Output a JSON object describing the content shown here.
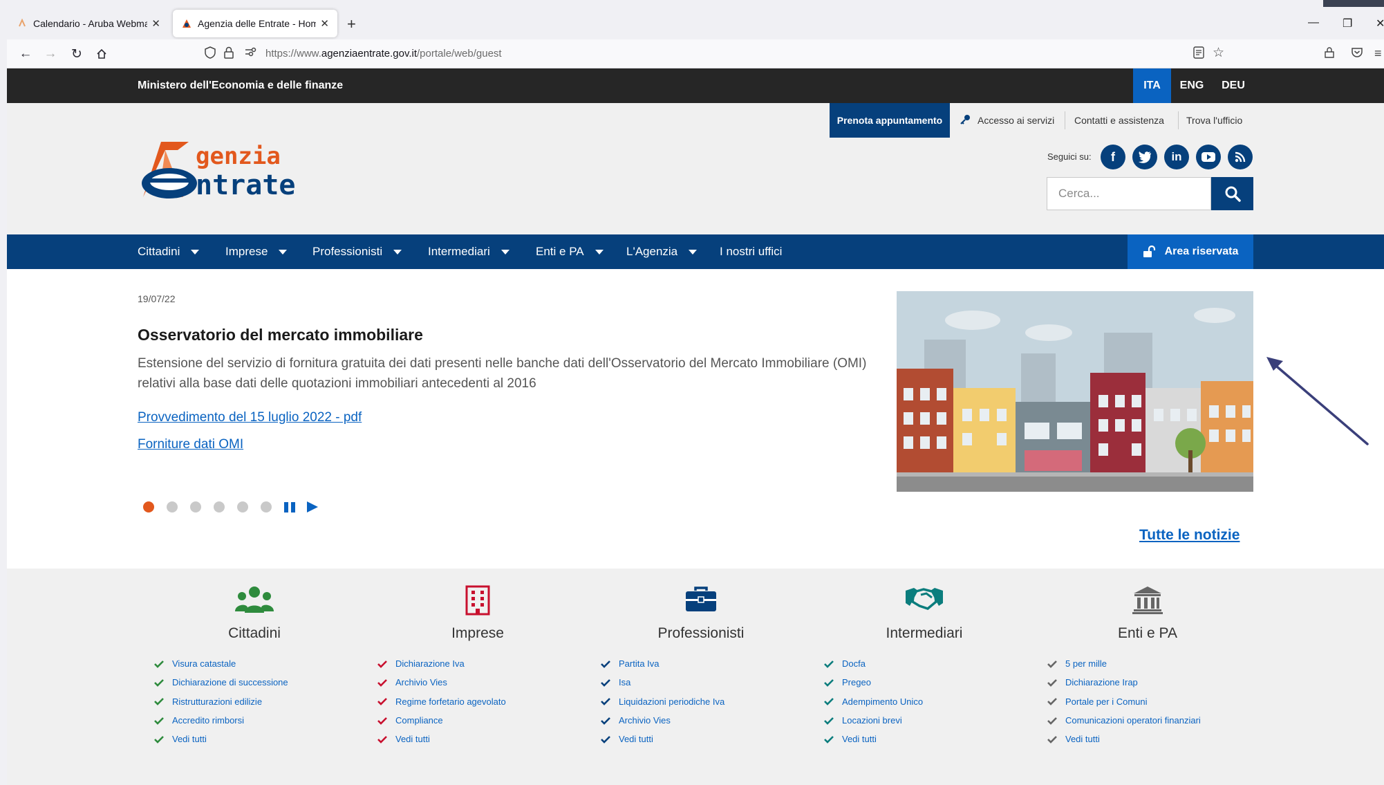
{
  "browser": {
    "tabs": [
      {
        "title": "Calendario - Aruba Webmail",
        "favicon": "aruba-icon",
        "active": false
      },
      {
        "title": "Agenzia delle Entrate - Home",
        "favicon": "agenzia-icon",
        "active": true
      }
    ],
    "url_prefix": "https://www.",
    "url_domain": "agenziaentrate.gov.it",
    "url_path": "/portale/web/guest"
  },
  "ministry_bar": {
    "name": "Ministero dell'Economia e delle finanze",
    "languages": [
      "ITA",
      "ENG",
      "DEU"
    ],
    "active_language": "ITA"
  },
  "header": {
    "logo_text_top": "genzia",
    "logo_text_bottom": "ntrate",
    "links": {
      "prenota": "Prenota appuntamento",
      "accesso": "Accesso ai servizi",
      "contatti": "Contatti e assistenza",
      "trova": "Trova l'ufficio"
    },
    "seguici": "Seguici su:",
    "search_placeholder": "Cerca..."
  },
  "main_nav": {
    "items": [
      "Cittadini",
      "Imprese",
      "Professionisti",
      "Intermediari",
      "Enti e PA",
      "L'Agenzia",
      "I nostri uffici"
    ],
    "area_riservata": "Area riservata"
  },
  "news": {
    "date": "19/07/22",
    "title": "Osservatorio del mercato immobiliare",
    "description": "Estensione del servizio di fornitura gratuita dei dati presenti nelle banche dati dell'Osservatorio del Mercato Immobiliare (OMI) relativi alla base dati delle quotazioni immobiliari antecedenti al 2016",
    "links": [
      "Provvedimento del 15 luglio 2022 - pdf",
      "Forniture dati OMI"
    ],
    "slide_count": 6,
    "active_slide": 1,
    "all_news": "Tutte le notizie"
  },
  "categories": [
    {
      "title": "Cittadini",
      "icon": "people-icon",
      "color": "#2e8b3d",
      "items": [
        "Visura catastale",
        "Dichiarazione di successione",
        "Ristrutturazioni edilizie",
        "Accredito rimborsi",
        "Vedi tutti"
      ]
    },
    {
      "title": "Imprese",
      "icon": "building-icon",
      "color": "#c8102e",
      "items": [
        "Dichiarazione Iva",
        "Archivio Vies",
        "Regime forfetario agevolato",
        "Compliance",
        "Vedi tutti"
      ]
    },
    {
      "title": "Professionisti",
      "icon": "briefcase-icon",
      "color": "#06407c",
      "items": [
        "Partita Iva",
        "Isa",
        "Liquidazioni periodiche Iva",
        "Archivio Vies",
        "Vedi tutti"
      ]
    },
    {
      "title": "Intermediari",
      "icon": "handshake-icon",
      "color": "#0b7d7d",
      "items": [
        "Docfa",
        "Pregeo",
        "Adempimento Unico",
        "Locazioni brevi",
        "Vedi tutti"
      ]
    },
    {
      "title": "Enti e PA",
      "icon": "institution-icon",
      "color": "#666666",
      "items": [
        "5 per mille",
        "Dichiarazione Irap",
        "Portale per i Comuni",
        "Comunicazioni operatori finanziari",
        "Vedi tutti"
      ]
    }
  ],
  "colors": {
    "brand_blue": "#06407c",
    "accent_blue": "#0a63c1",
    "brand_orange": "#e2581d",
    "dark_bar": "#262626"
  }
}
